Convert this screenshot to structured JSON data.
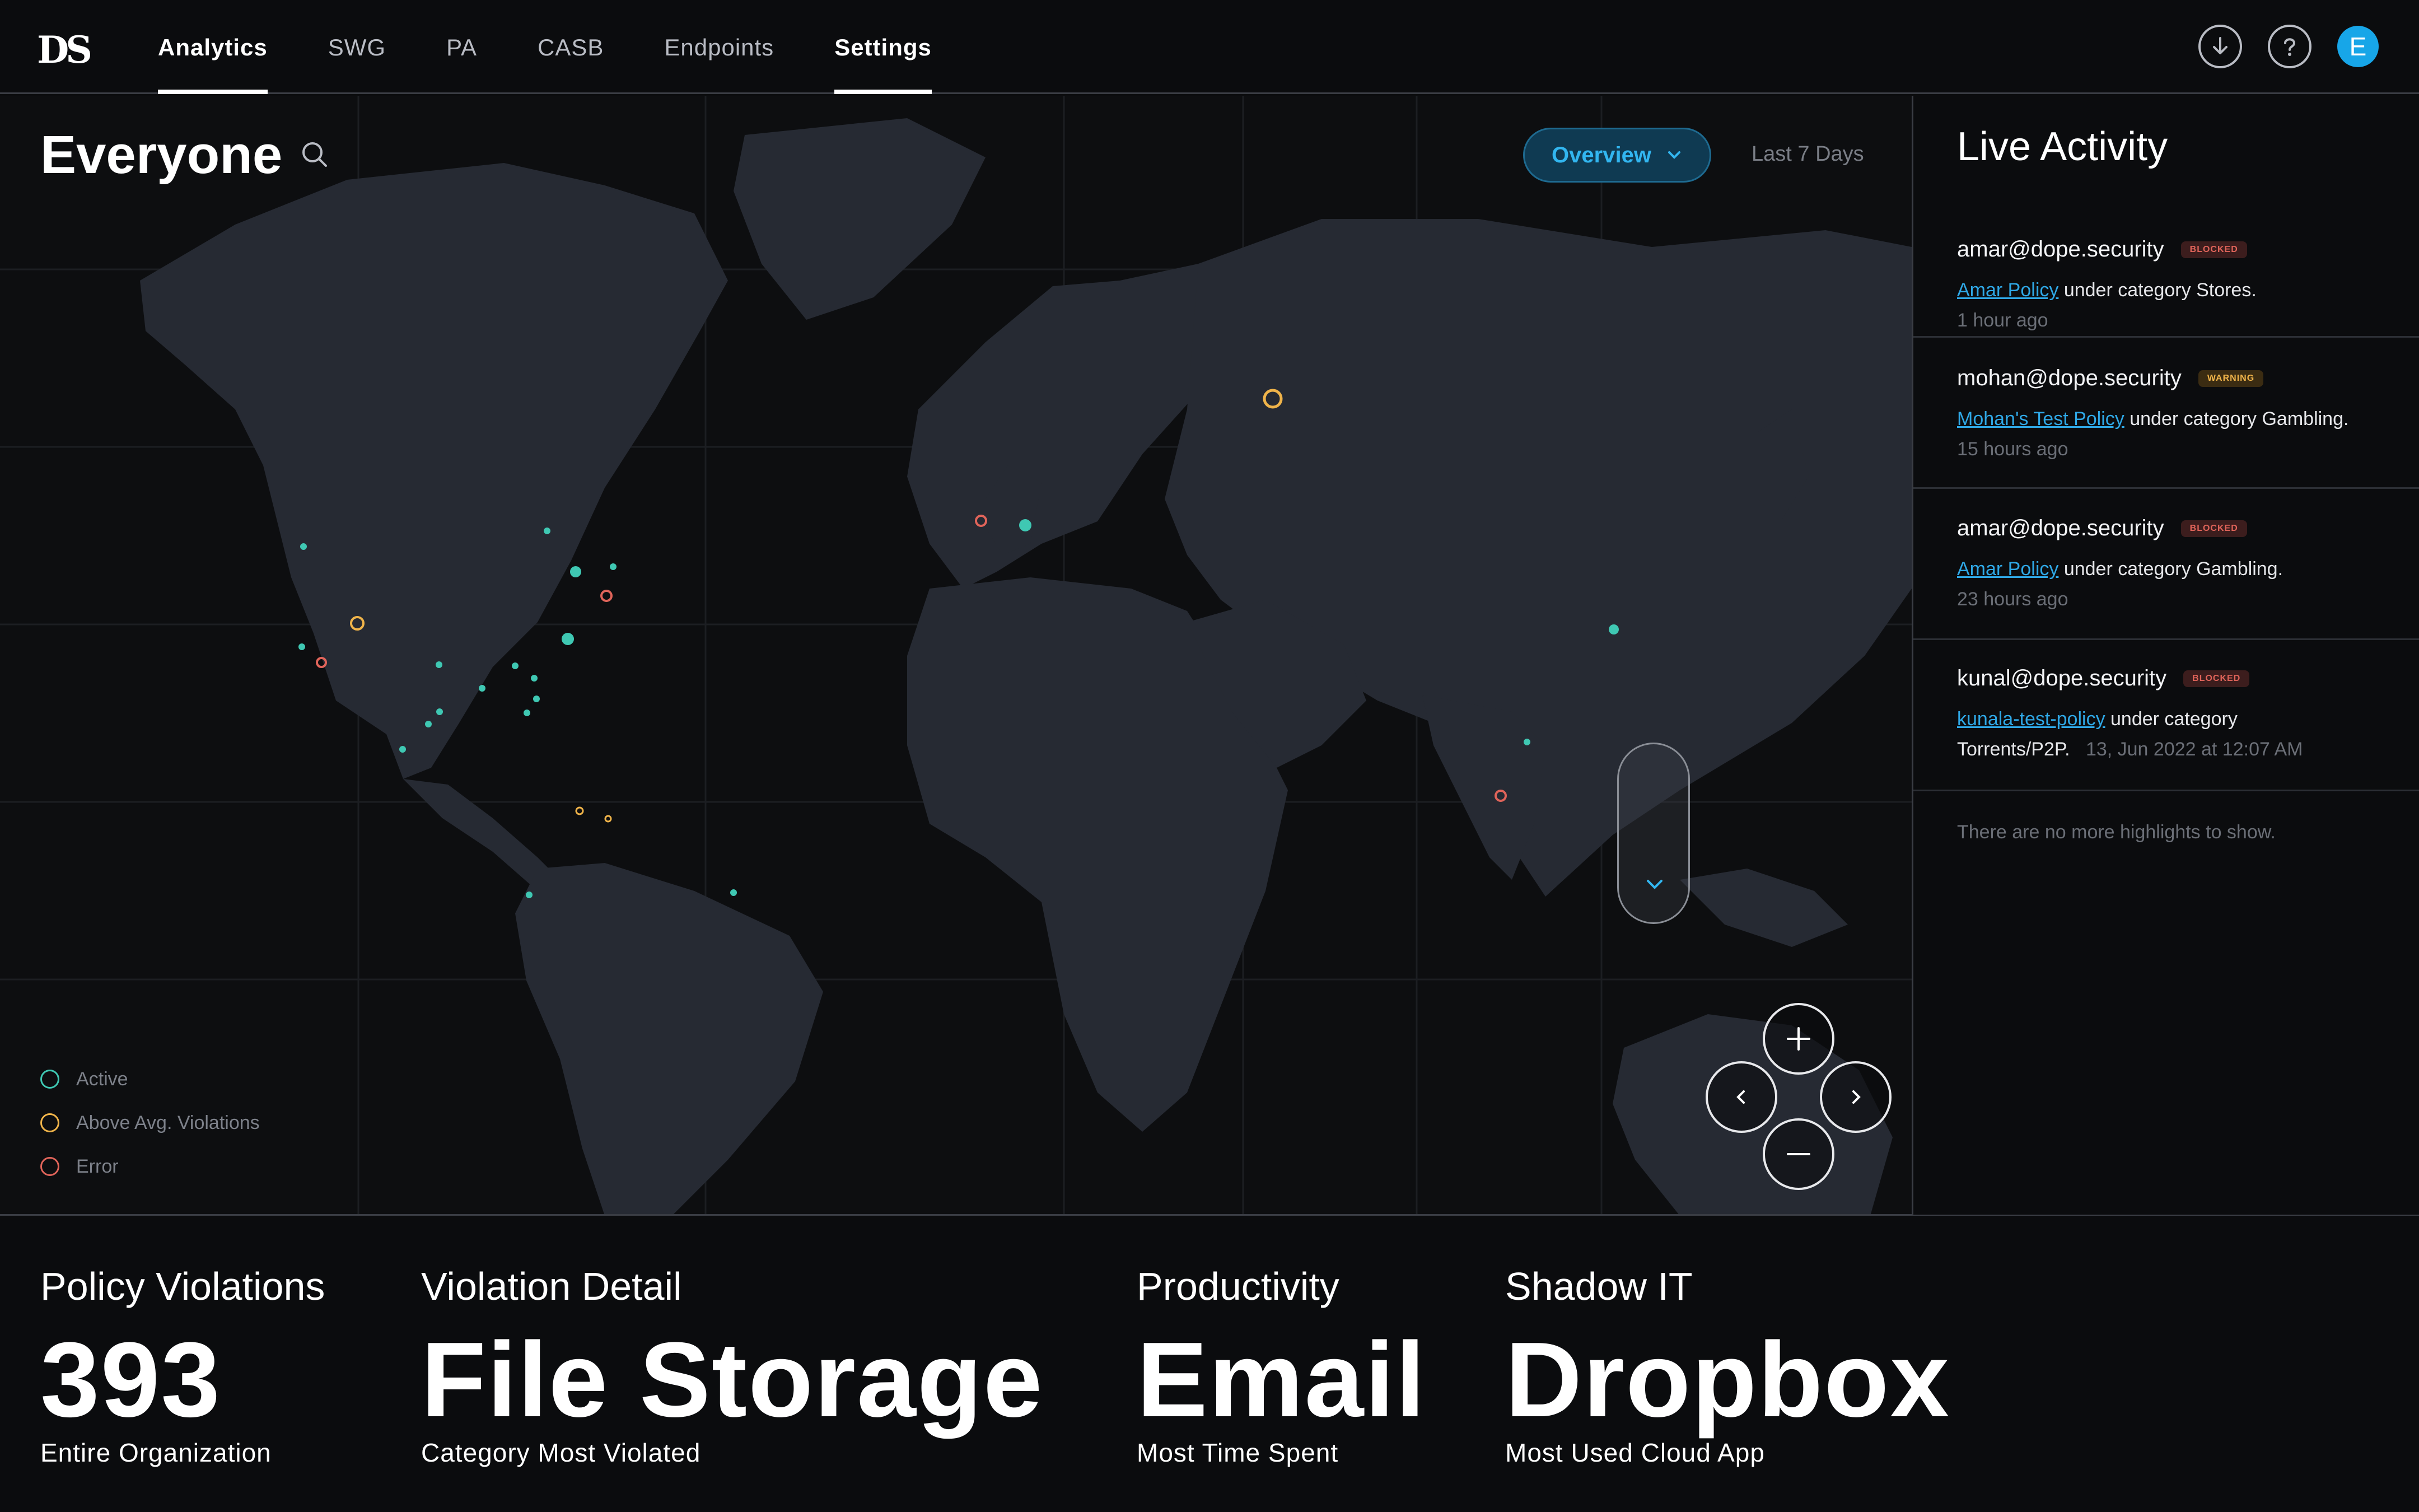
{
  "app": {
    "logo": "DS"
  },
  "nav": {
    "items": [
      {
        "label": "Analytics",
        "active": true
      },
      {
        "label": "SWG",
        "active": false
      },
      {
        "label": "PA",
        "active": false
      },
      {
        "label": "CASB",
        "active": false
      },
      {
        "label": "Endpoints",
        "active": false
      },
      {
        "label": "Settings",
        "active": true
      }
    ],
    "icons": [
      "download-icon",
      "help-icon"
    ],
    "avatar_initial": "E"
  },
  "map": {
    "title": "Everyone",
    "view_select": "Overview",
    "time_range": "Last 7 Days",
    "legend": [
      {
        "label": "Active",
        "color": "#3fc8b3"
      },
      {
        "label": "Above Avg. Violations",
        "color": "#f0b44a"
      },
      {
        "label": "Error",
        "color": "#e0645a"
      }
    ],
    "colors": {
      "active": "#3fc8b3",
      "warning": "#f0b44a",
      "error": "#e0645a",
      "accent": "#2fa8e6"
    }
  },
  "activity": {
    "title": "Live Activity",
    "items": [
      {
        "user": "amar@dope.security",
        "badge": "BLOCKED",
        "policy": "Amar Policy",
        "text": " under category Stores.",
        "time": "1 hour ago"
      },
      {
        "user": "mohan@dope.security",
        "badge": "WARNING",
        "policy": "Mohan's Test Policy",
        "text": " under category Gambling.",
        "time": "15 hours ago"
      },
      {
        "user": "amar@dope.security",
        "badge": "BLOCKED",
        "policy": "Amar Policy",
        "text": " under category Gambling.",
        "time": "23 hours ago"
      },
      {
        "user": "kunal@dope.security",
        "badge": "BLOCKED",
        "policy": "kunala-test-policy",
        "text": " under category Torrents/P2P.",
        "time": "13, Jun 2022 at 12:07 AM"
      }
    ],
    "no_more": "There are no more highlights to show."
  },
  "stats": [
    {
      "label": "Policy Violations",
      "value": "393",
      "sub": "Entire Organization"
    },
    {
      "label": "Violation Detail",
      "value": "File Storage",
      "sub": "Category Most Violated"
    },
    {
      "label": "Productivity",
      "value": "Email",
      "sub": "Most Time Spent"
    },
    {
      "label": "Shadow IT",
      "value": "Dropbox",
      "sub": "Most Used Cloud App"
    }
  ]
}
